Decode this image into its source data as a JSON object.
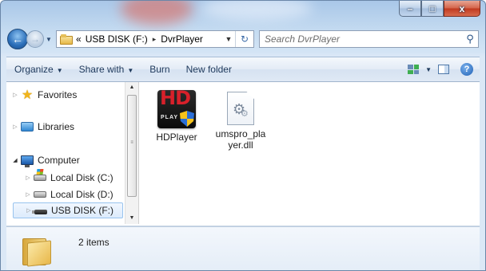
{
  "window": {
    "caption_buttons": {
      "minimize": "–",
      "maximize": "□",
      "close": "x"
    }
  },
  "address_bar": {
    "overflow": "«",
    "crumbs": [
      "USB DISK (F:)",
      "DvrPlayer"
    ],
    "separator": "▸",
    "dropdown": "▼",
    "refresh": "↻"
  },
  "search": {
    "placeholder": "Search DvrPlayer",
    "icon": "search-icon"
  },
  "command_bar": {
    "organize": "Organize",
    "share_with": "Share with",
    "burn": "Burn",
    "new_folder": "New folder",
    "dropdown_arrow": "▼",
    "help": "?"
  },
  "nav_pane": {
    "favorites": "Favorites",
    "libraries": "Libraries",
    "computer": "Computer",
    "local_c": "Local Disk (C:)",
    "local_d": "Local Disk (D:)",
    "usb_f": "USB DISK (F:)",
    "expand_glyph": "▷",
    "collapse_glyph": "◢"
  },
  "files": [
    {
      "name": "HDPlayer",
      "icon": "hdplayer-app-icon"
    },
    {
      "name": "umspro_pla\nyer.dll",
      "icon": "dll-file-icon"
    }
  ],
  "details": {
    "items": "2 items"
  }
}
